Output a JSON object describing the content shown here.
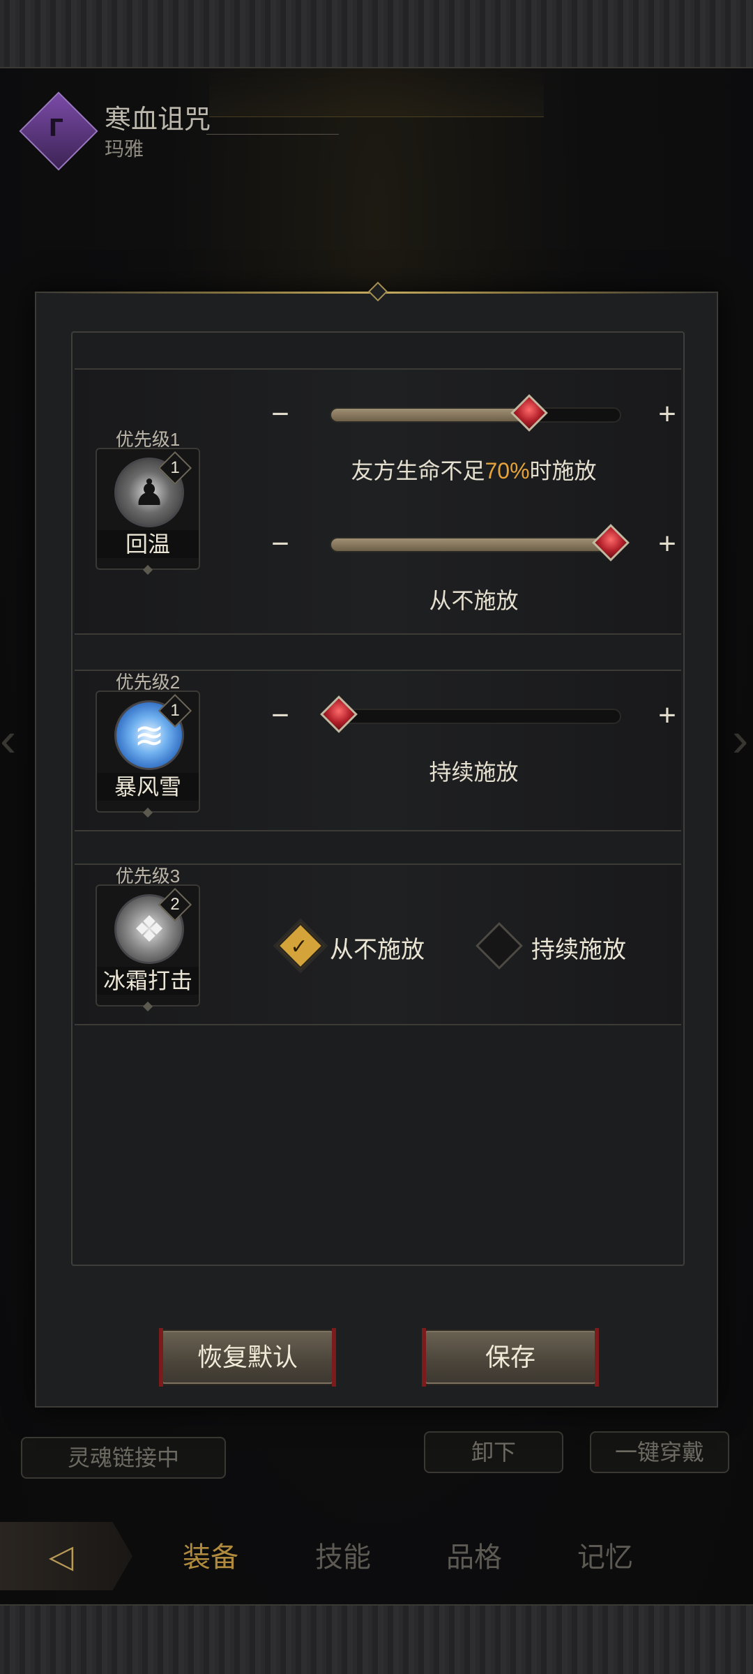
{
  "header": {
    "title": "寒血诅咒",
    "subtitle": "玛雅",
    "class_icon": "curse-scythe-icon"
  },
  "background": {
    "soul_link": "灵魂链接中",
    "unequip": "卸下",
    "equip_all": "一键穿戴"
  },
  "nav": {
    "back_icon": "back-arrow-icon",
    "tabs": [
      {
        "label": "装备",
        "active": true
      },
      {
        "label": "技能",
        "active": false
      },
      {
        "label": "品格",
        "active": false
      },
      {
        "label": "记忆",
        "active": false
      }
    ]
  },
  "modal": {
    "skills": [
      {
        "priority": "优先级1",
        "name": "回温",
        "level": "1",
        "icon": "warm-figure-icon",
        "sliders": [
          {
            "fraction": 0.7,
            "caption_pre": "友方生命不足",
            "caption_hl": "70%",
            "caption_post": "时施放"
          },
          {
            "fraction": 1.0,
            "caption": "从不施放"
          }
        ]
      },
      {
        "priority": "优先级2",
        "name": "暴风雪",
        "level": "1",
        "icon": "blizzard-icon",
        "sliders": [
          {
            "fraction": 0.0,
            "caption": "持续施放"
          }
        ]
      },
      {
        "priority": "优先级3",
        "name": "冰霜打击",
        "level": "2",
        "icon": "frost-strike-icon",
        "options": [
          {
            "label": "从不施放",
            "checked": true
          },
          {
            "label": "持续施放",
            "checked": false
          }
        ]
      }
    ],
    "buttons": {
      "reset": "恢复默认",
      "save": "保存"
    },
    "minus": "−",
    "plus": "+",
    "check_mark": "✓"
  },
  "colors": {
    "highlight": "#e6a33a",
    "accent_gold": "#b08b3e",
    "knob_red": "#b2202a"
  }
}
